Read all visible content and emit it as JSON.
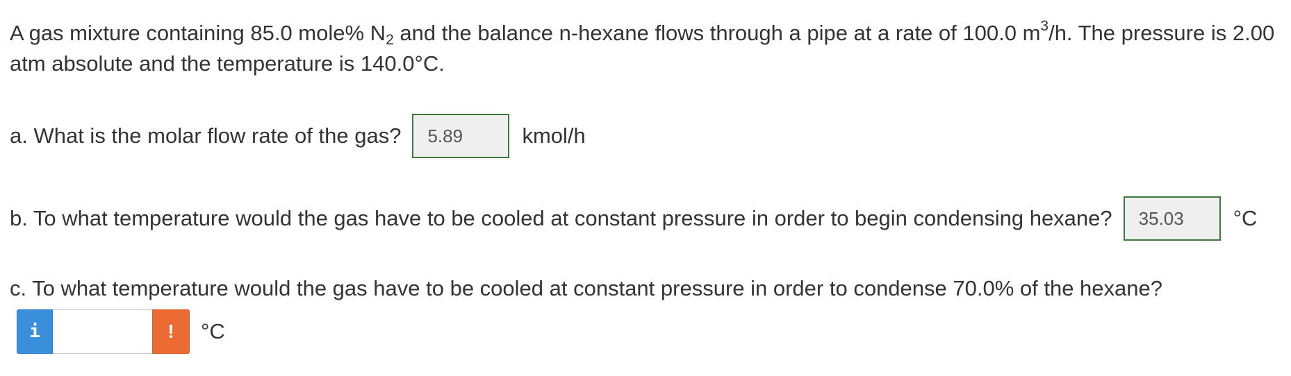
{
  "problem": {
    "part1": "A gas mixture containing 85.0 mole% N",
    "sub1": "2",
    "part2": " and the balance n-hexane flows through a pipe at a rate of 100.0 m",
    "sup1": "3",
    "part3": "/h. The pressure is 2.00 atm absolute and the temperature is 140.0°C."
  },
  "questions": {
    "a": {
      "text": "a. What is the molar flow rate of the gas?",
      "answer": "5.89",
      "unit": "kmol/h"
    },
    "b": {
      "text": "b. To what temperature would the gas have to be cooled at constant pressure in order to begin condensing hexane?",
      "answer": "35.03",
      "unit": "°C"
    },
    "c": {
      "text": "c. To what temperature would the gas have to be cooled at constant pressure in order to condense 70.0% of the hexane?",
      "answer": "",
      "unit": "°C",
      "info_glyph": "i",
      "warn_glyph": "!"
    }
  },
  "colors": {
    "correct_border": "#3c7a3c",
    "info_button": "#3a8fdc",
    "warning_button": "#ec6b34"
  },
  "icons": {
    "info": "info-icon",
    "warning": "warning-icon"
  }
}
